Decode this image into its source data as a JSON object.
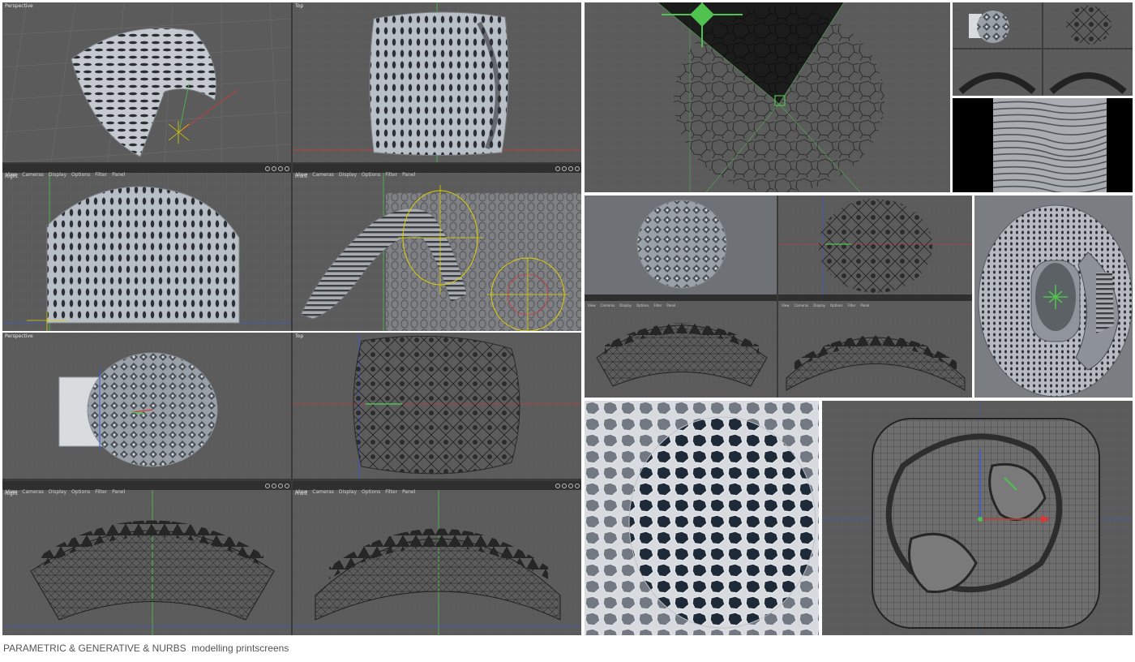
{
  "viewport_labels": {
    "perspective": "Perspective",
    "top": "Top",
    "right": "Right",
    "front": "Front"
  },
  "viewport_menu": [
    "View",
    "Cameras",
    "Display",
    "Options",
    "Filter",
    "Panel"
  ],
  "icons": {
    "viewport_move": "move-arrows-icon",
    "viewport_down": "down-arrow-icon",
    "viewport_zoom": "zoom-icon",
    "viewport_maximize": "maximize-icon"
  },
  "colors": {
    "viewport_bg": "#5a5a5a",
    "grid_line": "#6a6a6a",
    "axis_green": "#4fc24f",
    "axis_red": "#d23a3a",
    "axis_blue": "#3a5ad2",
    "spline_yellow": "#e0d000",
    "caption_text": "#555555"
  },
  "caption": "PARAMETRIC & GENERATIVE & NURBS  modelling printscreens"
}
